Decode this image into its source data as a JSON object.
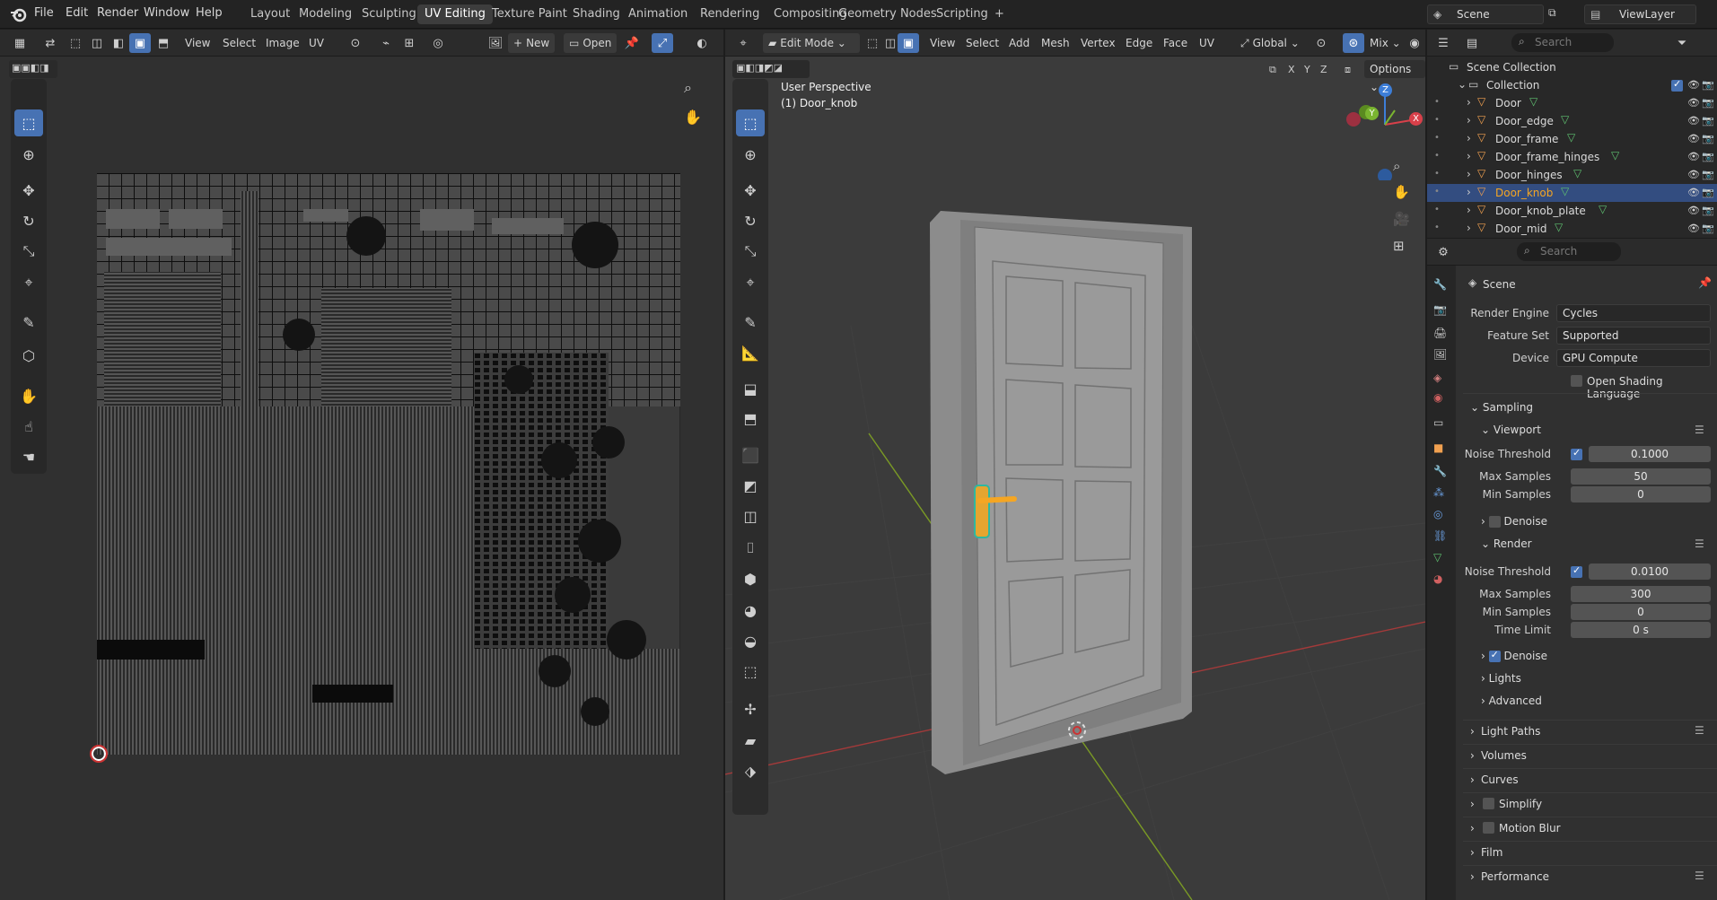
{
  "topbar": {
    "menus": [
      "File",
      "Edit",
      "Render",
      "Window",
      "Help"
    ],
    "workspaces": [
      "Layout",
      "Modeling",
      "Sculpting",
      "UV Editing",
      "Texture Paint",
      "Shading",
      "Animation",
      "Rendering",
      "Compositing",
      "Geometry Nodes",
      "Scripting"
    ],
    "active_workspace": "UV Editing",
    "add": "+",
    "scene": "Scene",
    "view_layer": "ViewLayer"
  },
  "uv_editor": {
    "menus": [
      "View",
      "Select",
      "Image",
      "UV"
    ],
    "new": "New",
    "open": "Open"
  },
  "viewport": {
    "mode": "Edit Mode",
    "menus": [
      "View",
      "Select",
      "Add",
      "Mesh",
      "Vertex",
      "Edge",
      "Face",
      "UV"
    ],
    "orientation": "Global",
    "shading": "Mix",
    "options": "Options",
    "axes": [
      "X",
      "Y",
      "Z"
    ],
    "overlay_title": "User Perspective",
    "overlay_object": "(1) Door_knob",
    "gizmo": {
      "z": "Z",
      "y": "Y",
      "x": "X"
    }
  },
  "outliner": {
    "search_placeholder": "Search",
    "root": "Scene Collection",
    "collection": "Collection",
    "items": [
      "Door",
      "Door_edge",
      "Door_frame",
      "Door_frame_hinges",
      "Door_hinges",
      "Door_knob",
      "Door_knob_plate",
      "Door_mid"
    ],
    "selected": "Door_knob"
  },
  "properties": {
    "search_placeholder": "Search",
    "context": "Scene",
    "render_engine_label": "Render Engine",
    "render_engine": "Cycles",
    "feature_set_label": "Feature Set",
    "feature_set": "Supported",
    "device_label": "Device",
    "device": "GPU Compute",
    "osl_label": "Open Shading Language",
    "sampling": "Sampling",
    "viewport": "Viewport",
    "noise_threshold_label": "Noise Threshold",
    "vp_noise": "0.1000",
    "max_samples_label": "Max Samples",
    "vp_max": "50",
    "min_samples_label": "Min Samples",
    "vp_min": "0",
    "denoise": "Denoise",
    "render": "Render",
    "r_noise": "0.0100",
    "r_max": "300",
    "r_min": "0",
    "time_limit_label": "Time Limit",
    "time_limit": "0 s",
    "lights": "Lights",
    "advanced": "Advanced",
    "panels": [
      "Light Paths",
      "Volumes",
      "Curves",
      "Simplify",
      "Motion Blur",
      "Film",
      "Performance"
    ]
  },
  "colors": {
    "accent": "#4772b3",
    "selected_orange": "#f5a623"
  }
}
